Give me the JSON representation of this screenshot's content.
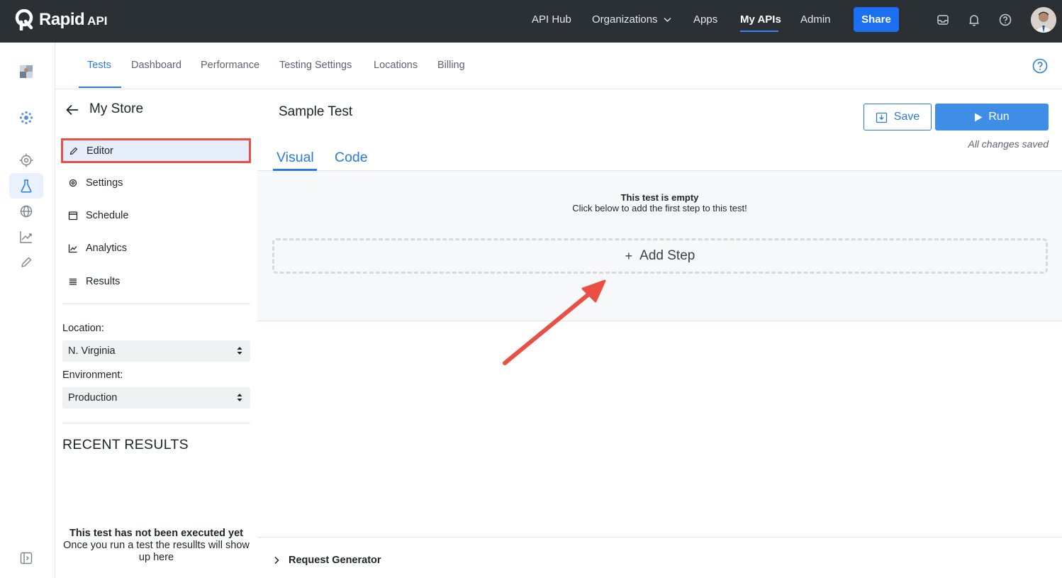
{
  "topbar": {
    "logo_text": "Rapid",
    "logo_sub": "API",
    "nav": [
      "API Hub",
      "Organizations",
      "Apps",
      "My APIs",
      "Admin"
    ],
    "active_nav": "My APIs",
    "share_label": "Share",
    "icons": [
      "inbox-icon",
      "bell-icon",
      "help-circle-icon"
    ]
  },
  "rail": {
    "icons": [
      "org-avatar",
      "hub-icon",
      "target-icon",
      "flask-icon",
      "globe-icon",
      "chart-icon",
      "pencil-icon",
      "sidebar-toggle-icon"
    ],
    "active": "flask-icon"
  },
  "tabs": {
    "items": [
      "Tests",
      "Dashboard",
      "Performance",
      "Testing Settings",
      "Locations",
      "Billing"
    ],
    "active": "Tests"
  },
  "left_panel": {
    "title": "My Store",
    "menu": [
      {
        "label": "Editor",
        "icon": "pencil-icon"
      },
      {
        "label": "Settings",
        "icon": "gear-icon"
      },
      {
        "label": "Schedule",
        "icon": "calendar-icon"
      },
      {
        "label": "Analytics",
        "icon": "analytics-icon"
      },
      {
        "label": "Results",
        "icon": "list-icon"
      }
    ],
    "selected": "Editor",
    "location_label": "Location:",
    "location_value": "N. Virginia",
    "environment_label": "Environment:",
    "environment_value": "Production",
    "recent_title": "RECENT RESULTS",
    "empty_title": "This test has not been executed yet",
    "empty_body": "Once you run a test the resullts will show up here"
  },
  "main": {
    "test_title": "Sample Test",
    "save_label": "Save",
    "run_label": "Run",
    "saved_note": "All changes saved",
    "view_tabs": [
      "Visual",
      "Code"
    ],
    "active_view": "Visual",
    "empty_title": "This test is empty",
    "empty_sub": "Click below to add the first step to this test!",
    "add_step_label": "Add Step",
    "request_generator_label": "Request Generator"
  },
  "colors": {
    "topbar_bg": "#2b3035",
    "accent": "#2b7bde",
    "share_bg": "#1d6ff2",
    "run_bg": "#3e8ee8",
    "highlight": "#ea4f45"
  }
}
